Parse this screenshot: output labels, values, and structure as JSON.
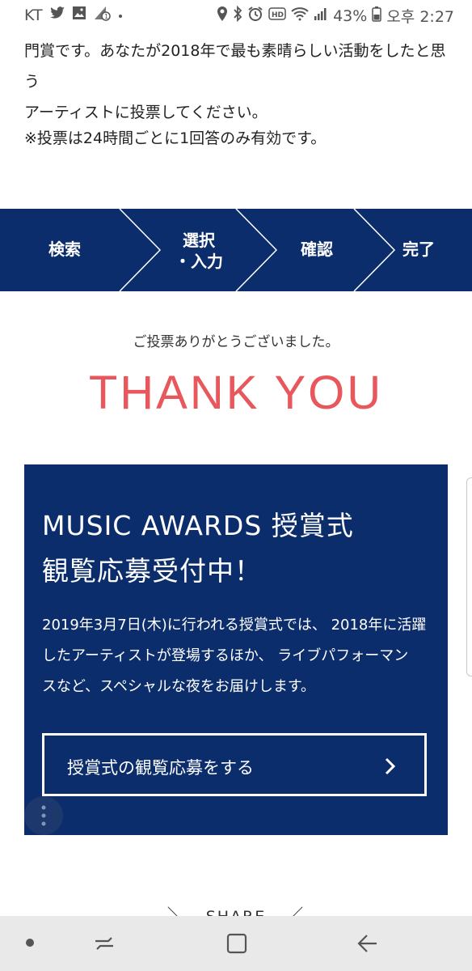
{
  "status_bar": {
    "carrier": "KT",
    "icons_left": [
      "twitter-icon",
      "image-icon",
      "signal-alert-icon",
      "dot-icon"
    ],
    "icons_right": [
      "location-icon",
      "bluetooth-icon",
      "alarm-icon",
      "hd-icon",
      "wifi-icon",
      "signal-icon",
      "battery-icon"
    ],
    "battery": "43%",
    "time": "오후 2:27"
  },
  "intro": {
    "line1": "門賞です。あなたが2018年で最も素晴らしい活動をしたと思う",
    "line2": "アーティストに投票してください。",
    "note": "※投票は24時間ごとに1回答のみ有効です。"
  },
  "steps": [
    {
      "label": "検索"
    },
    {
      "label": "選択",
      "label2": "・入力"
    },
    {
      "label": "確認"
    },
    {
      "label": "完了"
    }
  ],
  "thanks": {
    "sub": "ご投票ありがとうございました。",
    "main": "THANK YOU",
    "main_color": "#e8575c"
  },
  "card": {
    "title_line1": "MUSIC AWARDS 授賞式",
    "title_line2": "観覧応募受付中！",
    "body_line1": "2019年3月7日(木)に行われる授賞式では、 2018年に活躍",
    "body_line2": "したアーティストが登場するほか、 ライブパフォーマン",
    "body_line3": "スなど、スペシャルな夜をお届けします。",
    "cta_label": "授賞式の観覧応募をする",
    "background": "#0c2d6b"
  },
  "share": {
    "label": "SHARE"
  }
}
